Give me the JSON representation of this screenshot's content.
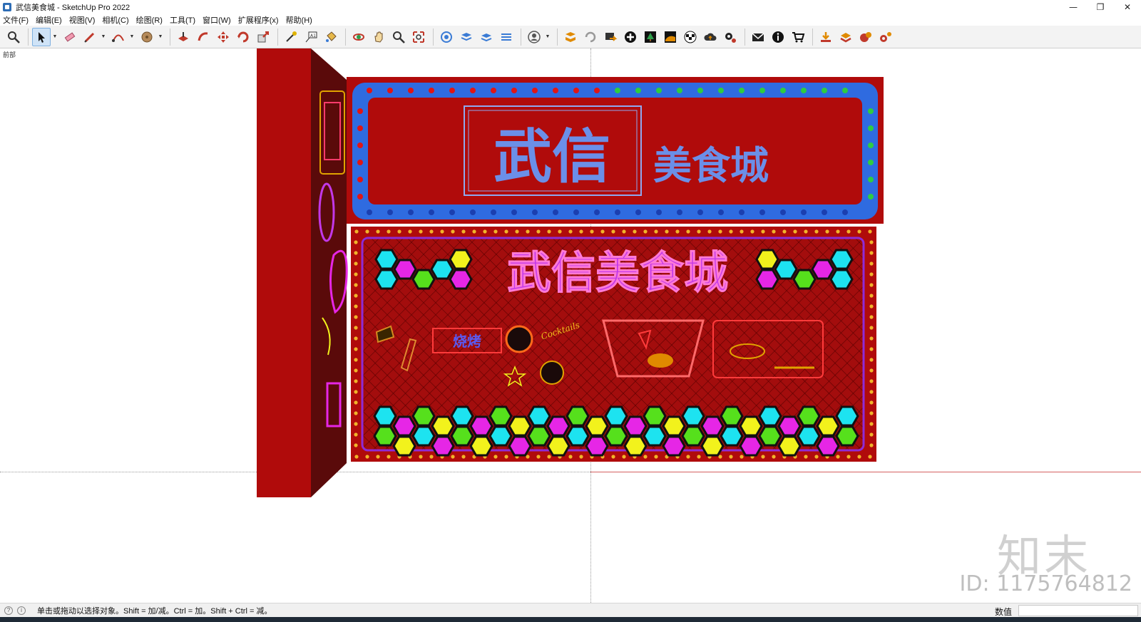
{
  "window": {
    "title": "武信美食城 - SketchUp Pro 2022",
    "controls": [
      "—",
      "❐",
      "✕"
    ]
  },
  "menu": [
    "文件(F)",
    "编辑(E)",
    "视图(V)",
    "相机(C)",
    "绘图(R)",
    "工具(T)",
    "窗口(W)",
    "扩展程序(x)",
    "帮助(H)"
  ],
  "toolbar": {
    "tools": [
      "zoom",
      "select",
      "eraser",
      "pencil",
      "arc",
      "paint",
      "push-pull",
      "follow-me",
      "move",
      "rotate",
      "scale",
      "tape",
      "text",
      "paint-bucket",
      "orbit",
      "pan",
      "zoom",
      "zoom-extents",
      "components",
      "layers",
      "styles",
      "materials",
      "user",
      "warehouse",
      "refresh",
      "export",
      "add",
      "tree",
      "sandbox",
      "checker",
      "cloud",
      "settings",
      "mail",
      "info",
      "cart",
      "download",
      "upload",
      "render",
      "gear"
    ]
  },
  "viewport": {
    "scene_label": "前部",
    "sign_top": {
      "big": "武信",
      "small": "美食城"
    },
    "sign_bottom": {
      "title": "武信美食城",
      "bbq": "烧烤",
      "cocktails": "Cocktails"
    },
    "watermark_logo": "知末",
    "watermark_id": "ID: 1175764812"
  },
  "status": {
    "text": "单击或拖动以选择对象。Shift = 加/减。Ctrl = 加。Shift + Ctrl = 减。",
    "measure_label": "数值",
    "measure_value": ""
  },
  "colors": {
    "sign_red": "#b80d0d",
    "sign_blue": "#2f6be0",
    "text_blue": "#6b8fe8",
    "neon_purple": "#c238e8",
    "hex_cyan": "#1de3f0",
    "hex_magenta": "#e626e6",
    "hex_green": "#56e01c",
    "hex_yellow": "#f2f21c"
  }
}
